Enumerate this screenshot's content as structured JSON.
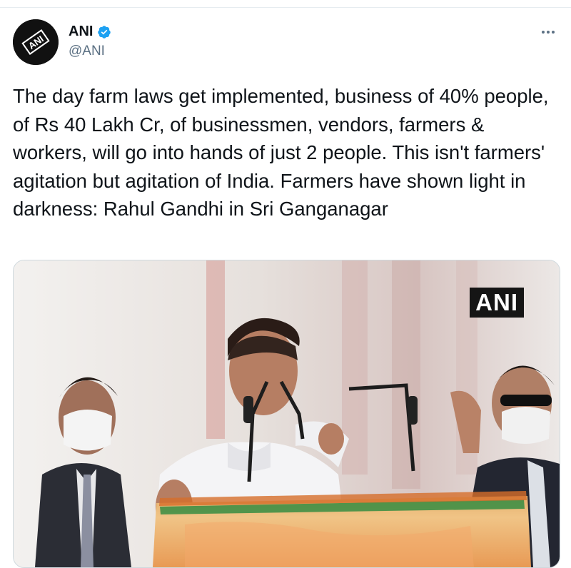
{
  "tweet": {
    "author": {
      "display_name": "ANI",
      "handle": "@ANI",
      "avatar_text": "ANI",
      "verified": true
    },
    "text": "The day farm laws get implemented, business of 40% people, of Rs 40 Lakh Cr, of businessmen, vendors, farmers & workers, will go into hands of just 2 people. This isn't farmers' agitation but agitation of India. Farmers have shown light in darkness: Rahul Gandhi in Sri Ganganagar",
    "media": {
      "watermark": "ANI"
    }
  },
  "colors": {
    "text_primary": "#0f1419",
    "text_secondary": "#5b7083",
    "verified_blue": "#1da1f2",
    "border": "#cfd9de"
  },
  "icons": {
    "verified": "verified-badge-icon",
    "more": "more-options-icon"
  }
}
